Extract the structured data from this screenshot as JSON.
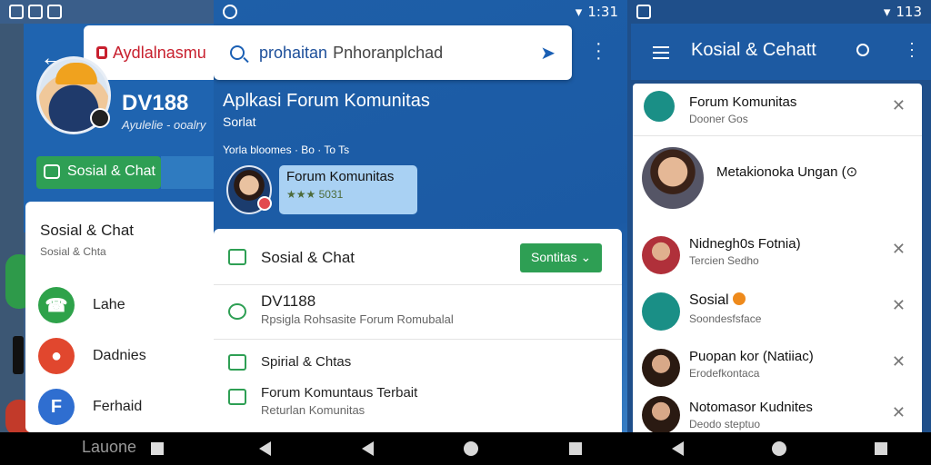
{
  "panel1": {
    "status_time": "",
    "tab_label": "Aydlalnasmu",
    "profile_name": "DV188",
    "profile_subtitle": "Ayulelie - ooalry",
    "chip_label": "Sosial & Chat",
    "card_title": "Sosial & Chat",
    "card_subtitle": "Sosial & Chta",
    "items": [
      {
        "label": "Lahe",
        "glyph": "",
        "color": "#2ea24a"
      },
      {
        "label": "Dadnies",
        "glyph": "",
        "color": "#e1472e"
      },
      {
        "label": "Ferhaid",
        "glyph": "F",
        "color": "#2f6ed0"
      }
    ],
    "bottom_label": "Lauone"
  },
  "panel2": {
    "status_time": "1:31",
    "search_query_1": "prohaitan",
    "search_query_2": "Pnhoranplchad",
    "header_title": "Aplkasi Forum Komunitas",
    "header_sub": "Sorlat",
    "header_meta": "Yorla bloomes · Bo · To Ts",
    "card_title": "Forum Komunitas",
    "card_rating": "★★★ 5031",
    "rows": [
      {
        "title": "Sosial & Chat",
        "sub": "",
        "button": "Sontitas"
      },
      {
        "title": "DV1188",
        "sub": "Rpsigla Rohsasite Forum Romubalal",
        "button": ""
      },
      {
        "title": "Spirial & Chtas",
        "sub": "",
        "button": ""
      },
      {
        "title": "Forum Komuntaus Terbait",
        "sub": "Returlan Komunitas",
        "button": ""
      }
    ]
  },
  "panel3": {
    "status_time": "113",
    "title": "Kosial & Cehatt",
    "rows": [
      {
        "name": "Forum Komunitas",
        "sub": "Dooner Gos",
        "color": "#1a8f86",
        "x": true
      },
      {
        "name": "Metakionoka Ungan (⊙",
        "sub": "",
        "color": "#6b3a2a",
        "x": false
      },
      {
        "name": "Nidnegh0s Fotnia)",
        "sub": "Tercien Sedho",
        "color": "#b03a3a",
        "x": true
      },
      {
        "name": "Sosial",
        "sub": "Soondesfsface",
        "color": "#1a8f86",
        "x": true
      },
      {
        "name": "Puopan kor (Natiiac)",
        "sub": "Erodefkontaca",
        "color": "#4a2a1a",
        "x": true
      },
      {
        "name": "Notomasor Kudnites",
        "sub": "Deodo steptuo",
        "color": "#3a2a1a",
        "x": true
      }
    ]
  }
}
